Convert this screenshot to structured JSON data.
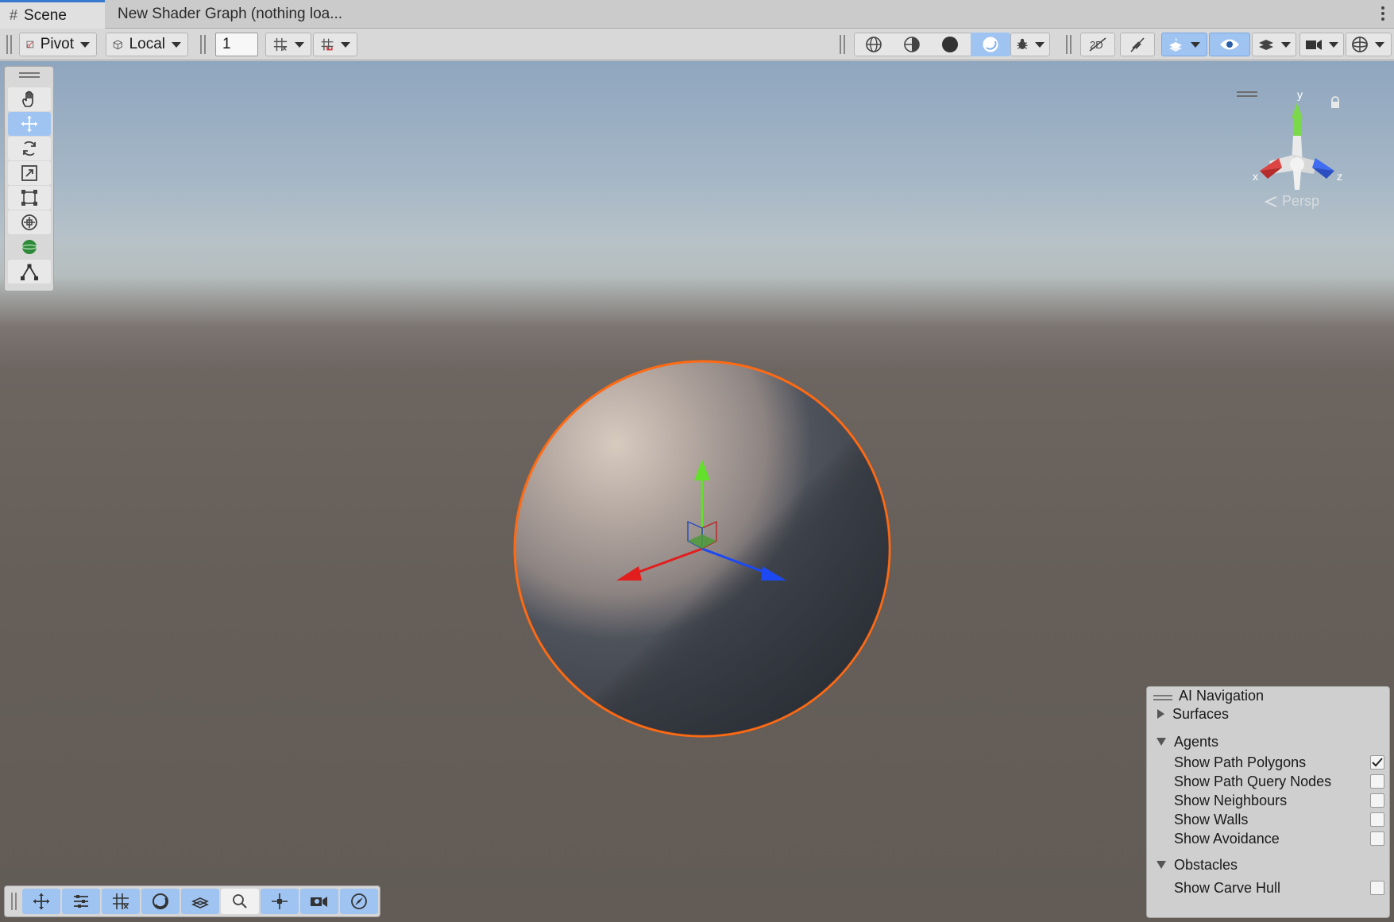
{
  "tabs": {
    "scene_label": "Scene",
    "shader_label": "New Shader Graph (nothing loa..."
  },
  "toolbar": {
    "pivot_label": "Pivot",
    "local_label": "Local",
    "grid_snap_value": "1"
  },
  "view": {
    "projection_label": "Persp",
    "axis_x": "x",
    "axis_y": "y",
    "axis_z": "z"
  },
  "ai_navigation": {
    "title": "AI Navigation",
    "surfaces_label": "Surfaces",
    "agents_label": "Agents",
    "agent_options": [
      {
        "label": "Show Path Polygons",
        "checked": true
      },
      {
        "label": "Show Path Query Nodes",
        "checked": false
      },
      {
        "label": "Show Neighbours",
        "checked": false
      },
      {
        "label": "Show Walls",
        "checked": false
      },
      {
        "label": "Show Avoidance",
        "checked": false
      }
    ],
    "obstacles_label": "Obstacles",
    "obstacle_options": [
      {
        "label": "Show Carve Hull",
        "checked": false
      }
    ]
  },
  "colors": {
    "selection_outline": "#ff6a13",
    "axis_x": "#e21d1d",
    "axis_y": "#62e02b",
    "axis_z": "#1d49f2",
    "active_blue": "#9fc4f2"
  }
}
